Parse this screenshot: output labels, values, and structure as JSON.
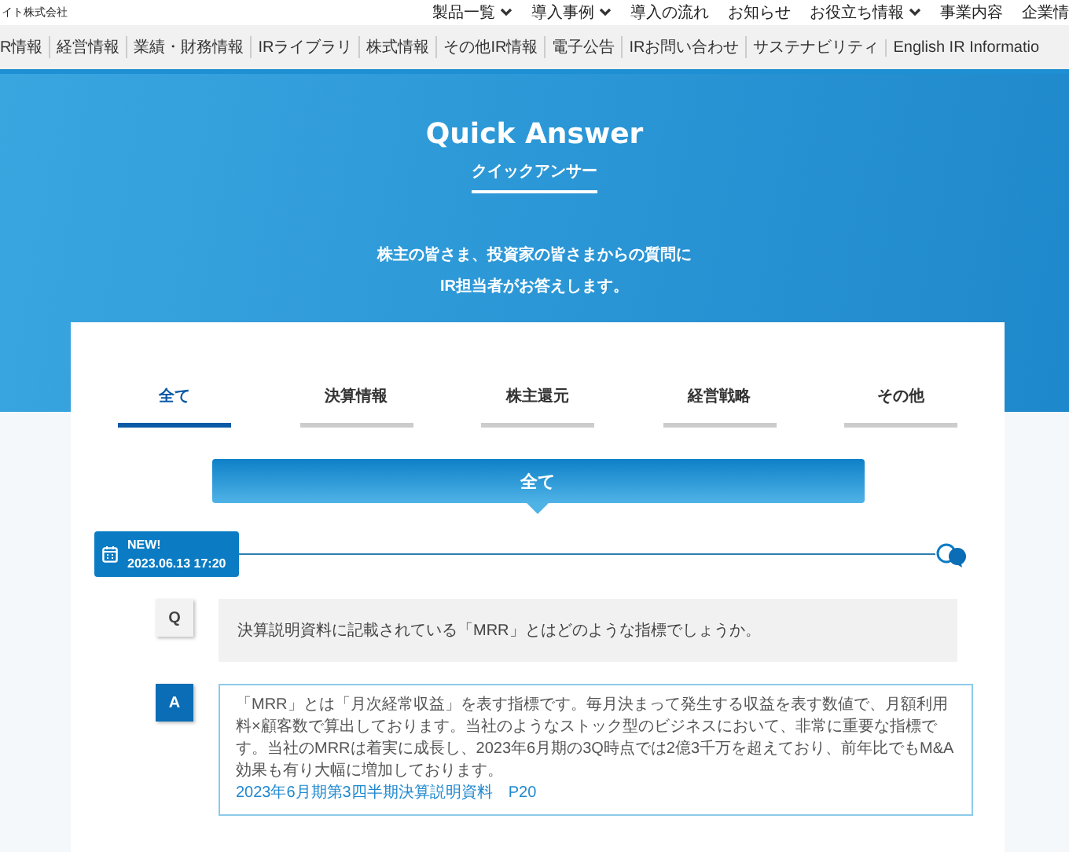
{
  "header": {
    "company": "イト株式会社",
    "nav": [
      {
        "label": "製品一覧",
        "dropdown": true
      },
      {
        "label": "導入事例",
        "dropdown": true
      },
      {
        "label": "導入の流れ",
        "dropdown": false
      },
      {
        "label": "お知らせ",
        "dropdown": false
      },
      {
        "label": "お役立ち情報",
        "dropdown": true
      },
      {
        "label": "事業内容",
        "dropdown": false
      },
      {
        "label": "企業情",
        "dropdown": false
      }
    ]
  },
  "subnav": [
    "R情報",
    "経営情報",
    "業績・財務情報",
    "IRライブラリ",
    "株式情報",
    "その他IR情報",
    "電子公告",
    "IRお問い合わせ",
    "サステナビリティ",
    "English IR Informatio"
  ],
  "hero": {
    "title": "Quick Answer",
    "subtitle": "クイックアンサー",
    "lead": [
      "株主の皆さま、投資家の皆さまからの質問に",
      "IR担当者がお答えします。"
    ]
  },
  "tabs": [
    {
      "label": "全て",
      "selected": true
    },
    {
      "label": "決算情報",
      "selected": false
    },
    {
      "label": "株主還元",
      "selected": false
    },
    {
      "label": "経営戦略",
      "selected": false
    },
    {
      "label": "その他",
      "selected": false
    }
  ],
  "category_banner": "全て",
  "entries": [
    {
      "badge": "NEW!",
      "date": "2023.06.13 17:20",
      "q_mark": "Q",
      "question": "決算説明資料に記載されている「MRR」とはどのような指標でしょうか。",
      "a_mark": "A",
      "answer": "「MRR」とは「月次経常収益」を表す指標です。毎月決まって発生する収益を表す数値で、月額利用料×顧客数で算出しております。当社のようなストック型のビジネスにおいて、非常に重要な指標です。当社のMRRは着実に成長し、2023年6月期の3Q時点では2億3千万を超えており、前年比でもM&A効果も有り大幅に増加しております。",
      "source": "2023年6月期第3四半期決算説明資料　P20"
    }
  ]
}
